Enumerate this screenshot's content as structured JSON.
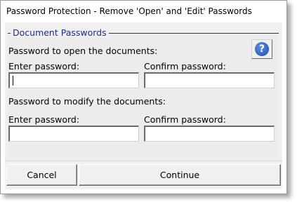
{
  "window": {
    "title": "Password Protection - Remove 'Open' and 'Edit' Passwords"
  },
  "frame": {
    "legend": "Document Passwords",
    "legend_color": "#1f2d8c"
  },
  "open_section": {
    "heading": "Password to open the documents:",
    "enter_label": "Enter password:",
    "confirm_label": "Confirm password:",
    "enter_value": "",
    "confirm_value": ""
  },
  "modify_section": {
    "heading": "Password to modify the documents:",
    "enter_label": "Enter password:",
    "confirm_label": "Confirm password:",
    "enter_value": "",
    "confirm_value": ""
  },
  "help": {
    "icon": "help-icon",
    "glyph": "?"
  },
  "buttons": {
    "cancel": "Cancel",
    "continue": "Continue"
  }
}
